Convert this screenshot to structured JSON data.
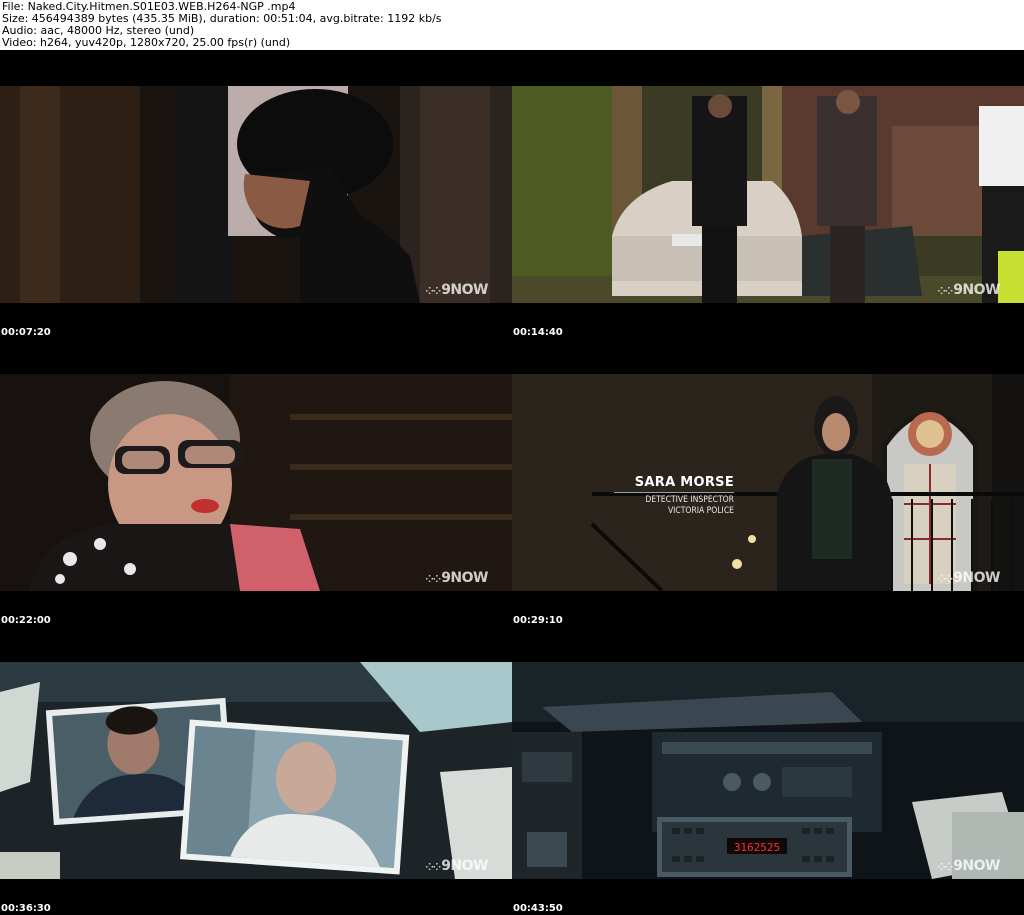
{
  "header": {
    "file": "File: Naked.City.Hitmen.S01E03.WEB.H264-NGP .mp4",
    "size": "Size: 456494389 bytes (435.35 MiB), duration: 00:51:04, avg.bitrate: 1192 kb/s",
    "audio": "Audio: aac, 48000 Hz, stereo (und)",
    "video": "Video: h264, yuv420p, 1280x720, 25.00 fps(r) (und)"
  },
  "watermark": {
    "dots": "⁘⁘",
    "text": "9NOW"
  },
  "frames": [
    {
      "timestamp": "00:07:20"
    },
    {
      "timestamp": "00:14:40"
    },
    {
      "timestamp": "00:22:00"
    },
    {
      "timestamp": "00:29:10",
      "lower_third": {
        "name": "SARA MORSE",
        "title": "DETECTIVE INSPECTOR",
        "org": "VICTORIA POLICE"
      }
    },
    {
      "timestamp": "00:36:30"
    },
    {
      "timestamp": "00:43:50"
    }
  ]
}
